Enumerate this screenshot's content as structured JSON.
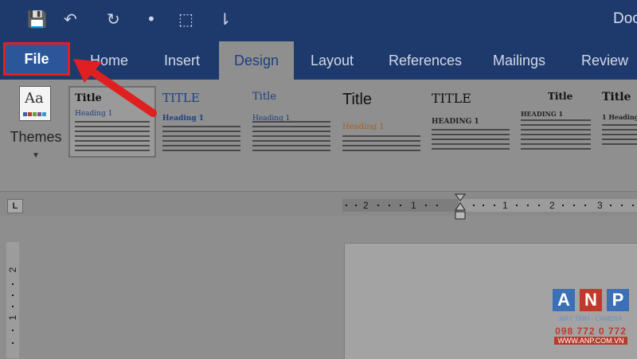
{
  "titlebar": {
    "title": "Doc",
    "qat": [
      {
        "icon": "save-icon",
        "glyph": "💾"
      },
      {
        "icon": "undo-icon",
        "glyph": "↶"
      },
      {
        "icon": "redo-icon",
        "glyph": "↻"
      },
      {
        "icon": "dot-icon",
        "glyph": "•"
      },
      {
        "icon": "touch-mode-icon",
        "glyph": "⬚"
      },
      {
        "icon": "customize-qat-icon",
        "glyph": "⇂"
      }
    ]
  },
  "tabs": {
    "file": "File",
    "home": "Home",
    "insert": "Insert",
    "design": "Design",
    "layout": "Layout",
    "references": "References",
    "mailings": "Mailings",
    "review": "Review"
  },
  "active_tab": "design",
  "ribbon": {
    "themes_label": "Themes",
    "styles": [
      {
        "title": "Title",
        "heading": "Heading 1",
        "selected": true
      },
      {
        "title": "TITLE",
        "heading": "Heading 1",
        "selected": false
      },
      {
        "title": "Title",
        "heading": "Heading 1",
        "selected": false
      },
      {
        "title": "Title",
        "heading": "Heading 1",
        "selected": false
      },
      {
        "title": "TITLE",
        "heading": "HEADING 1",
        "selected": false
      },
      {
        "title": "Title",
        "heading": "HEADING 1",
        "selected": false
      },
      {
        "title": "Title",
        "heading": "1 Heading",
        "selected": false
      }
    ]
  },
  "ruler": {
    "tab_selector": "L",
    "horizontal_labels": [
      "2",
      "1",
      "1",
      "2",
      "3"
    ],
    "vertical_labels": [
      "2",
      "1"
    ]
  },
  "watermark": {
    "letters": [
      "A",
      "N",
      "P"
    ],
    "tagline": "MÁY TÍNH - CAMERA",
    "phone": "098 772 0 772",
    "url": "WWW.ANP.COM.VN"
  },
  "colors": {
    "titlebar": "#1e3a6d",
    "file_tab": "#2b579a",
    "highlight": "#e02020",
    "watermark_blue": "#3b6fb6",
    "watermark_red": "#c0392b"
  }
}
